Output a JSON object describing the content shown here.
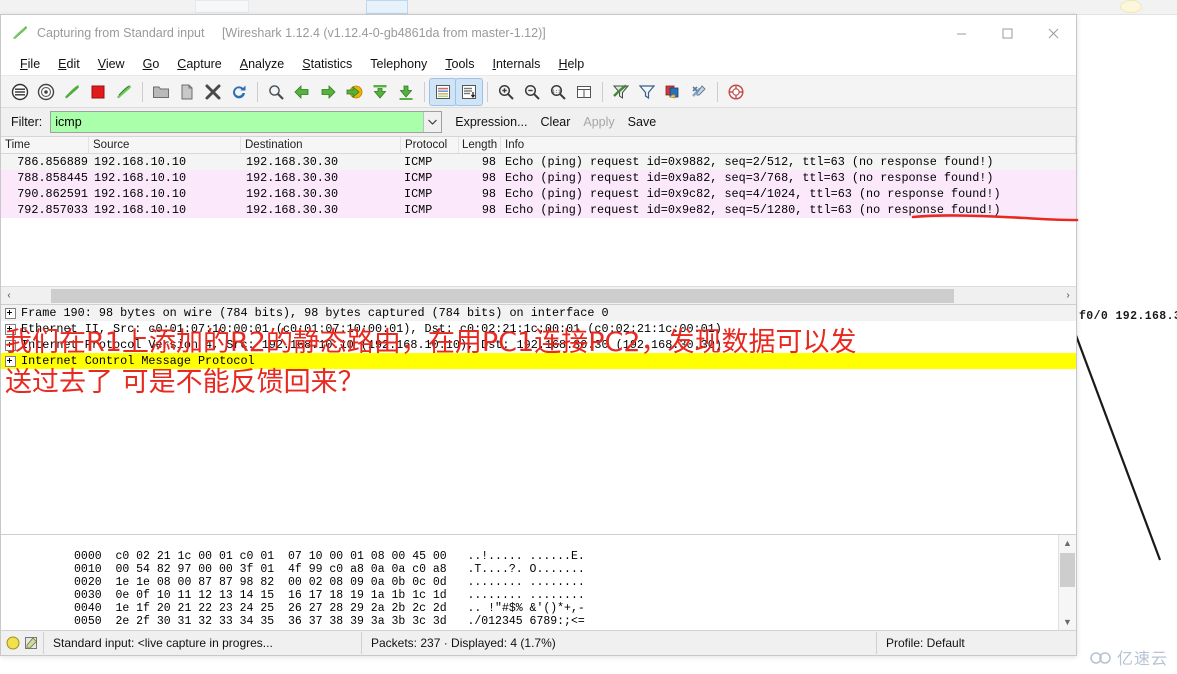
{
  "window": {
    "title_capture": "Capturing from Standard input",
    "title_version": "[Wireshark 1.12.4  (v1.12.4-0-gb4861da from master-1.12)]",
    "minimize": "—",
    "maximize": "□",
    "close": "✕"
  },
  "menu": {
    "items": [
      {
        "first": "F",
        "rest": "ile"
      },
      {
        "first": "E",
        "rest": "dit"
      },
      {
        "first": "V",
        "rest": "iew"
      },
      {
        "first": "G",
        "rest": "o"
      },
      {
        "first": "C",
        "rest": "apture"
      },
      {
        "first": "A",
        "rest": "nalyze"
      },
      {
        "first": "S",
        "rest": "tatistics"
      },
      {
        "first": "T",
        "rest": "elephony"
      },
      {
        "first": "T",
        "rest": "ools"
      },
      {
        "first": "I",
        "rest": "nternals"
      },
      {
        "first": "H",
        "rest": "elp"
      }
    ]
  },
  "toolbar": {
    "icons": [
      "interfaces-icon",
      "capture-options-icon",
      "start-capture-icon",
      "stop-capture-icon",
      "restart-capture-icon",
      "open-file-icon",
      "save-file-icon",
      "close-file-icon",
      "reload-icon",
      "find-packet-icon",
      "go-back-icon",
      "go-forward-icon",
      "go-to-packet-icon",
      "go-first-packet-icon",
      "go-last-packet-icon",
      "colorize-icon",
      "auto-scroll-icon",
      "zoom-in-icon",
      "zoom-out-icon",
      "zoom-reset-icon",
      "resize-columns-icon",
      "capture-filters-icon",
      "display-filters-icon",
      "coloring-rules-icon",
      "preferences-icon",
      "help-icon"
    ]
  },
  "filter": {
    "label": "Filter:",
    "value": "icmp",
    "placeholder": "",
    "expression_label": "Expression...",
    "clear_label": "Clear",
    "apply_label": "Apply",
    "save_label": "Save"
  },
  "packet_list": {
    "columns": [
      "Time",
      "Source",
      "Destination",
      "Protocol",
      "Length",
      "Info"
    ],
    "rows": [
      {
        "time": "786.856889",
        "source": "192.168.10.10",
        "destination": "192.168.30.30",
        "protocol": "ICMP",
        "length": "98",
        "info": "Echo (ping) request  id=0x9882, seq=2/512, ttl=63 (no response found!)"
      },
      {
        "time": "788.858445",
        "source": "192.168.10.10",
        "destination": "192.168.30.30",
        "protocol": "ICMP",
        "length": "98",
        "info": "Echo (ping) request  id=0x9a82, seq=3/768, ttl=63 (no response found!)"
      },
      {
        "time": "790.862591",
        "source": "192.168.10.10",
        "destination": "192.168.30.30",
        "protocol": "ICMP",
        "length": "98",
        "info": "Echo (ping) request  id=0x9c82, seq=4/1024, ttl=63 (no response found!)"
      },
      {
        "time": "792.857033",
        "source": "192.168.10.10",
        "destination": "192.168.30.30",
        "protocol": "ICMP",
        "length": "98",
        "info": "Echo (ping) request  id=0x9e82, seq=5/1280, ttl=63 (no response found!)"
      }
    ],
    "scroll_left_icon": "‹",
    "scroll_right_icon": "›"
  },
  "packet_details": {
    "rows": [
      {
        "text": "Frame 190: 98 bytes on wire (784 bits), 98 bytes captured (784 bits) on interface 0",
        "selected": false
      },
      {
        "text": "Ethernet II, Src: c0:01:07:10:00:01 (c0:01:07:10:00:01), Dst: c0:02:21:1c:00:01 (c0:02:21:1c:00:01)",
        "selected": false
      },
      {
        "text": "Internet Protocol Version 4, Src: 192.168.10.10 (192.168.10.10), Dst: 192.168.30.30 (192.168.30.30)",
        "selected": false
      },
      {
        "text": "Internet Control Message Protocol",
        "selected": true
      }
    ]
  },
  "annotation": {
    "line1": "我们在R1上添加的R2的静态路由，在用PC1连接PC2，发现数据可以发",
    "line2": "送过去了 可是不能反馈回来？",
    "color": "#e8291f"
  },
  "hex_dump": {
    "rows": [
      {
        "offset": "0000",
        "b1": "c0 02 21 1c 00 01 c0 01",
        "b2": "07 10 00 01 08 00 45 00",
        "ascii": "..!..... ......E."
      },
      {
        "offset": "0010",
        "b1": "00 54 82 97 00 00 3f 01",
        "b2": "4f 99 c0 a8 0a 0a c0 a8",
        "ascii": ".T....?. O......."
      },
      {
        "offset": "0020",
        "b1": "1e 1e 08 00 87 87 98 82",
        "b2": "00 02 08 09 0a 0b 0c 0d",
        "ascii": "........ ........"
      },
      {
        "offset": "0030",
        "b1": "0e 0f 10 11 12 13 14 15",
        "b2": "16 17 18 19 1a 1b 1c 1d",
        "ascii": "........ ........"
      },
      {
        "offset": "0040",
        "b1": "1e 1f 20 21 22 23 24 25",
        "b2": "26 27 28 29 2a 2b 2c 2d",
        "ascii": ".. !\"#$% &'()*+,-"
      },
      {
        "offset": "0050",
        "b1": "2e 2f 30 31 32 33 34 35",
        "b2": "36 37 38 39 3a 3b 3c 3d",
        "ascii": "./012345 6789:;<="
      }
    ],
    "scroll_up_icon": "▲",
    "scroll_down_icon": "▼"
  },
  "status_bar": {
    "capture_icon": "capture-status-icon",
    "expert_icon": "expert-info-icon",
    "source": "Standard input: <live capture in progres...",
    "counts": "Packets: 237 · Displayed: 4 (1.7%)",
    "profile": "Profile: Default"
  },
  "background": {
    "diagram_label": "f0/0   192.168.3",
    "watermark": "亿速云"
  },
  "colors": {
    "filter_valid_bg": "#aaffaa",
    "row_highlight": "#fbe9fb",
    "selected_detail": "#ffff00",
    "annotation_red": "#e8291f"
  }
}
